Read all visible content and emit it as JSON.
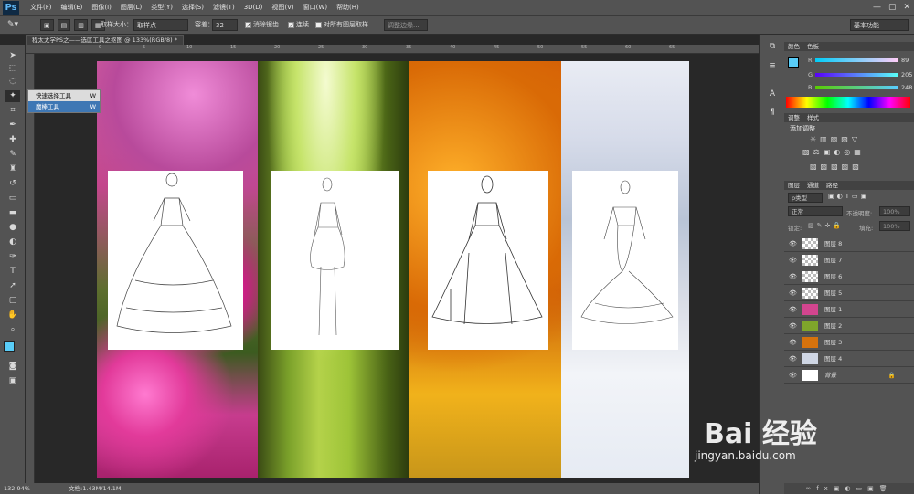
{
  "app": {
    "logo": "Ps"
  },
  "menus": [
    "文件(F)",
    "编辑(E)",
    "图像(I)",
    "图层(L)",
    "类型(Y)",
    "选择(S)",
    "滤镜(T)",
    "3D(D)",
    "视图(V)",
    "窗口(W)",
    "帮助(H)"
  ],
  "window_buttons": [
    "—",
    "▢",
    "✕"
  ],
  "options": {
    "sample_size_label": "取样大小：",
    "sample_size_value": "取样点",
    "tolerance_label": "容差：",
    "tolerance_value": "32",
    "antialias_label": "消除锯齿",
    "contiguous_label": "连续",
    "all_layers_label": "对所有图层取样",
    "refine_label": "调整边缘...",
    "workspace": "基本功能"
  },
  "document": {
    "tab_title": "程太太学PS之——选区工具之抠图 @ 133%(RGB/8) *",
    "zoom": "132.94%",
    "doc_info": "文档:1.43M/14.1M"
  },
  "ruler": [
    "0",
    "5",
    "10",
    "15",
    "20",
    "25",
    "30",
    "35",
    "40",
    "45",
    "50",
    "55",
    "60",
    "65"
  ],
  "tool_flyout": {
    "items": [
      {
        "label": "快速选择工具",
        "key": "W"
      },
      {
        "label": "魔棒工具",
        "key": "W"
      }
    ]
  },
  "color_panel": {
    "tabs": [
      "颜色",
      "色板"
    ],
    "r": "89",
    "g": "205",
    "b": "248",
    "fg": "#59cdf8",
    "bg": "#ffffff"
  },
  "adjust_panel": {
    "tabs": [
      "调整",
      "样式"
    ],
    "title": "添加调整"
  },
  "layers_panel": {
    "tabs": [
      "图层",
      "通道",
      "路径"
    ],
    "kind": "ρ类型",
    "blend": "正常",
    "opacity_label": "不透明度:",
    "opacity": "100%",
    "lock_label": "锁定:",
    "fill_label": "填充:",
    "fill": "100%",
    "layers": [
      {
        "name": "图层 8",
        "thumb": "checker"
      },
      {
        "name": "图层 7",
        "thumb": "checker"
      },
      {
        "name": "图层 6",
        "thumb": "checker"
      },
      {
        "name": "图层 5",
        "thumb": "checker"
      },
      {
        "name": "图层 1",
        "thumb": "#d2458f"
      },
      {
        "name": "图层 2",
        "thumb": "#7fa52b"
      },
      {
        "name": "图层 3",
        "thumb": "#d6720c"
      },
      {
        "name": "图层 4",
        "thumb": "#cfd6e4"
      },
      {
        "name": "背景",
        "thumb": "#ffffff"
      }
    ]
  },
  "watermark": {
    "text": "Bai 经验",
    "url": "jingyan.baidu.com"
  }
}
